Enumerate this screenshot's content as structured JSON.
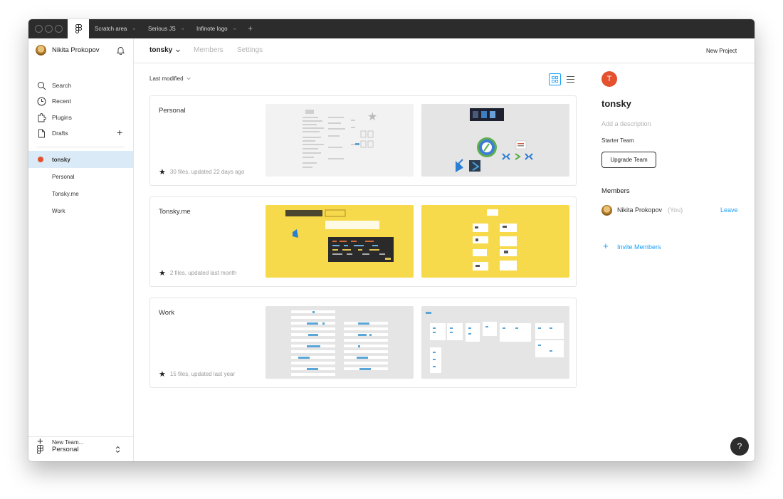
{
  "tabs": [
    {
      "label": "Scratch area"
    },
    {
      "label": "Serious JS"
    },
    {
      "label": "Infinote logo"
    }
  ],
  "tab_close": "×",
  "tab_add": "+",
  "sidebar": {
    "user_name": "Nikita Prokopov",
    "nav": [
      {
        "label": "Search",
        "icon": "search-icon"
      },
      {
        "label": "Recent",
        "icon": "clock-icon"
      },
      {
        "label": "Plugins",
        "icon": "plugin-icon"
      },
      {
        "label": "Drafts",
        "icon": "file-icon"
      }
    ],
    "drafts_add": "+",
    "teams": [
      {
        "label": "tonsky"
      },
      {
        "label": "Personal"
      },
      {
        "label": "Tonsky.me"
      },
      {
        "label": "Work"
      }
    ],
    "new_team_plus": "+",
    "new_team": "New Team...",
    "workspace": "Personal",
    "workspace_chevron": "⌃⌄"
  },
  "header": {
    "team_name": "tonsky",
    "chevron": "⌄",
    "tab_members": "Members",
    "tab_settings": "Settings",
    "new_project": "New Project"
  },
  "main": {
    "sort_label": "Last modified",
    "sort_chevron": "⌄",
    "projects": [
      {
        "name": "Personal",
        "meta": "30 files, updated 22 days ago"
      },
      {
        "name": "Tonsky.me",
        "meta": "2 files, updated last month"
      },
      {
        "name": "Work",
        "meta": "15 files, updated last year"
      }
    ]
  },
  "right_panel": {
    "avatar_letter": "T",
    "team_name": "tonsky",
    "description_placeholder": "Add a description",
    "plan": "Starter Team",
    "upgrade_button": "Upgrade Team",
    "members_heading": "Members",
    "member_name": "Nikita Prokopov",
    "member_you": "(You)",
    "leave_link": "Leave",
    "invite_plus": "+",
    "invite_label": "Invite Members"
  },
  "help": "?",
  "colors": {
    "accent_blue": "#18a0fb",
    "team_orange": "#e4512f",
    "active_bg": "#daebf7",
    "yellow_thumb": "#f7d94c",
    "gray_thumb": "#e5e5e5",
    "titlebar": "#2c2c2c"
  }
}
